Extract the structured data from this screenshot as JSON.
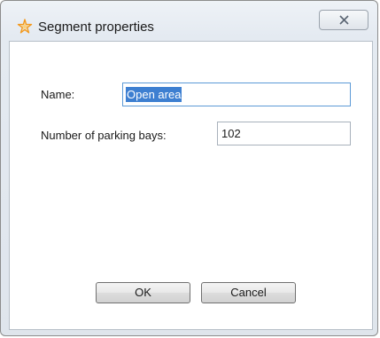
{
  "window": {
    "title": "Segment properties",
    "close_symbol": "✕",
    "title_icon": "star-icon",
    "close_icon": "close-icon"
  },
  "form": {
    "name_label": "Name:",
    "name_value": "Open area",
    "bays_label": "Number of parking bays:",
    "bays_value": "102"
  },
  "buttons": {
    "ok_label": "OK",
    "cancel_label": "Cancel"
  },
  "colors": {
    "selection": "#3d7fd1",
    "star": "#f39a1e"
  }
}
